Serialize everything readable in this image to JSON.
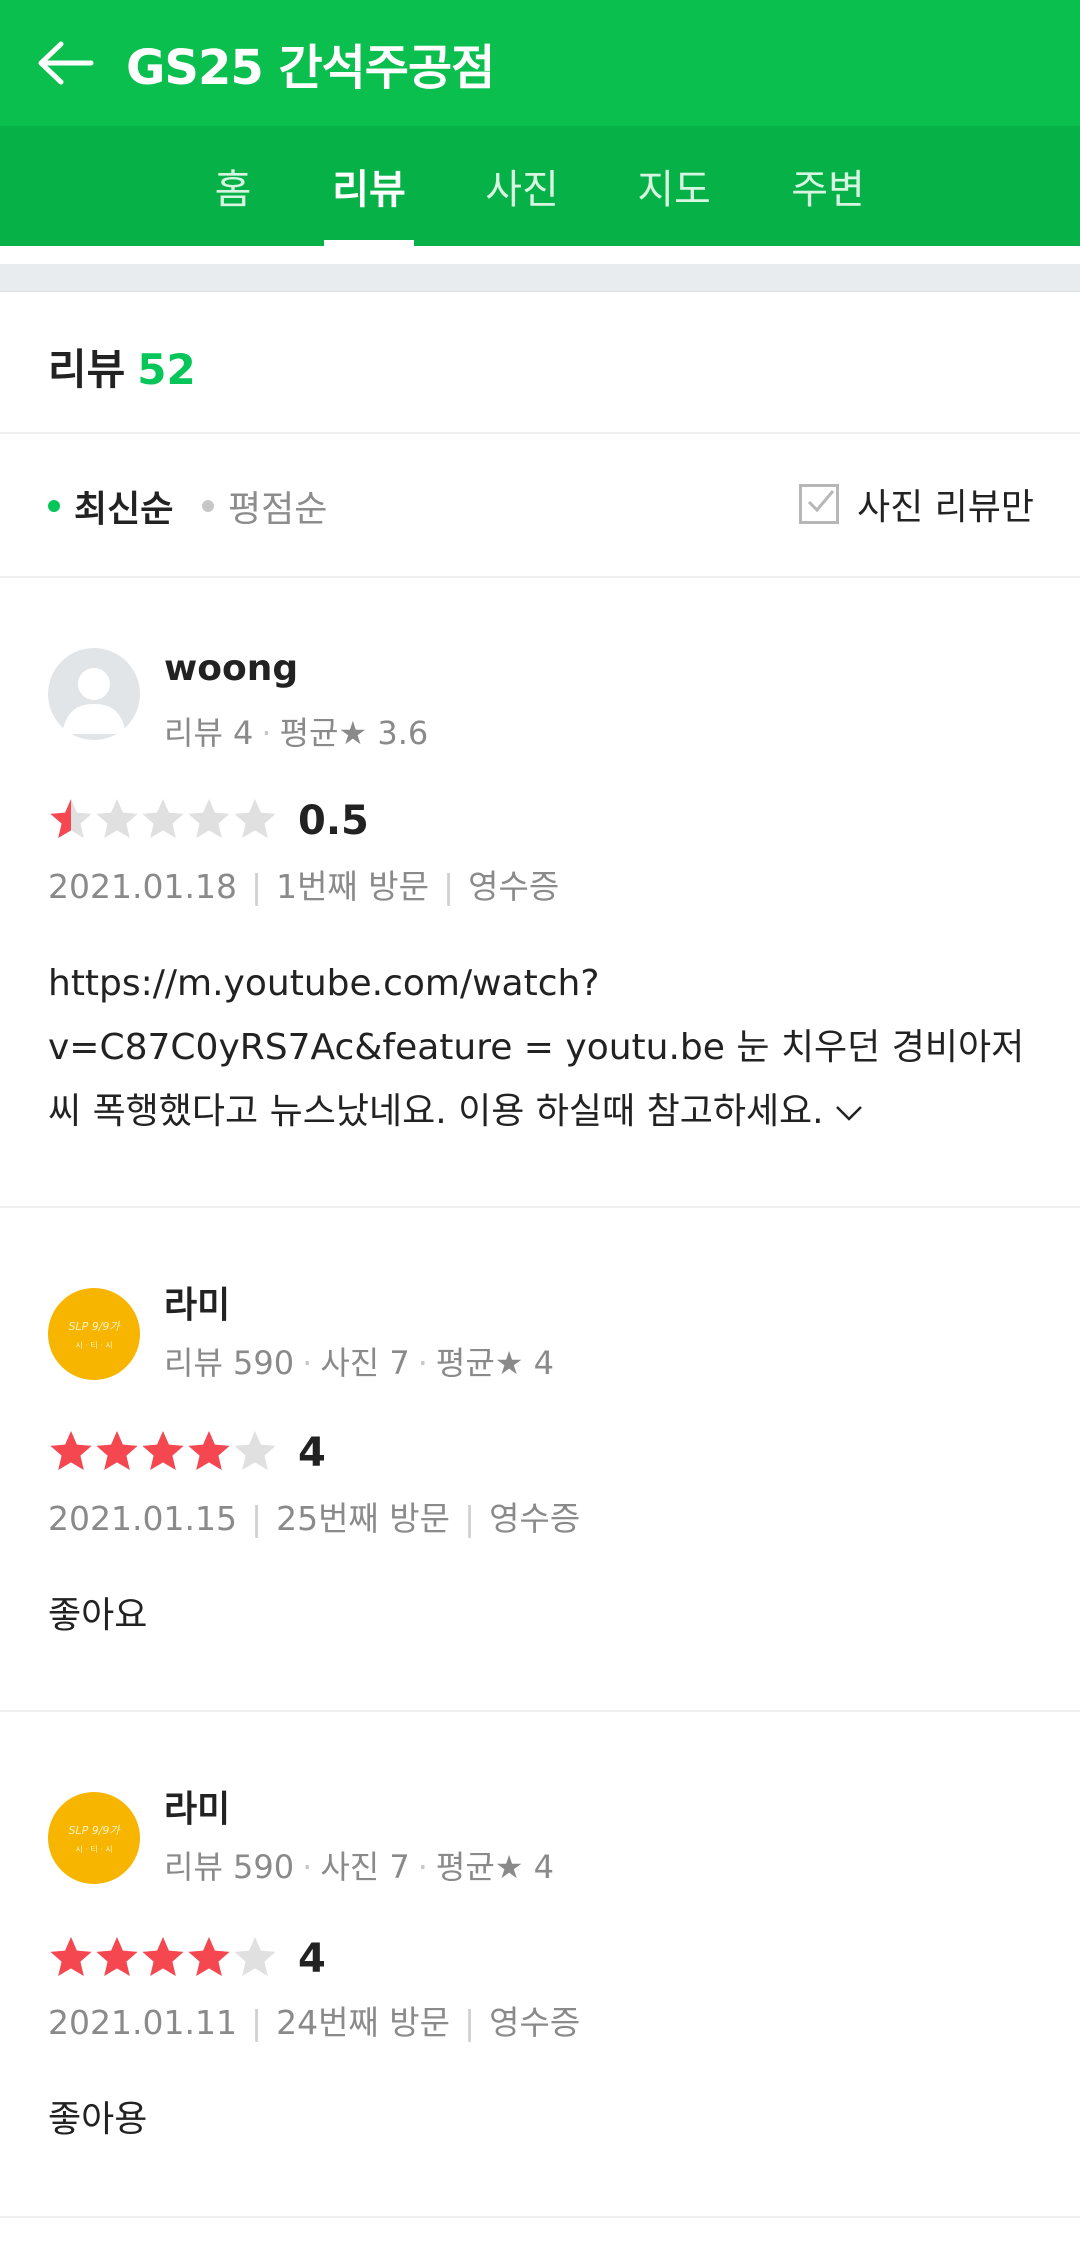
{
  "header": {
    "title": "GS25 간석주공점"
  },
  "tabs": [
    {
      "label": "홈",
      "active": false
    },
    {
      "label": "리뷰",
      "active": true
    },
    {
      "label": "사진",
      "active": false
    },
    {
      "label": "지도",
      "active": false
    },
    {
      "label": "주변",
      "active": false
    }
  ],
  "reviews_section": {
    "label": "리뷰",
    "count": "52"
  },
  "sort": {
    "latest": "최신순",
    "rating": "평점순",
    "photo_only": "사진 리뷰만"
  },
  "colors": {
    "brand_green": "#0abf4e",
    "tab_green": "#06b248",
    "star_red": "#f5474f",
    "star_gray": "#e0e0e0"
  },
  "reviews": [
    {
      "user": "woong",
      "meta": [
        "리뷰 4",
        "평균★ 3.6"
      ],
      "rating": 0.5,
      "rating_text": "0.5",
      "date": "2021.01.18",
      "visit": "1번째 방문",
      "receipt": "영수증",
      "text": "https://m.youtube.com/watch?v=C87C0yRS7Ac&feature = youtu.be 눈 치우던 경비아저씨 폭행했다고 뉴스났네요. 이용 하실때 참고하세요.",
      "avatar": "default"
    },
    {
      "user": "라미",
      "meta": [
        "리뷰 590",
        "사진 7",
        "평균★ 4"
      ],
      "rating": 4,
      "rating_text": "4",
      "date": "2021.01.15",
      "visit": "25번째 방문",
      "receipt": "영수증",
      "text": "좋아요",
      "avatar": "yellow"
    },
    {
      "user": "라미",
      "meta": [
        "리뷰 590",
        "사진 7",
        "평균★ 4"
      ],
      "rating": 4,
      "rating_text": "4",
      "date": "2021.01.11",
      "visit": "24번째 방문",
      "receipt": "영수증",
      "text": "좋아용",
      "avatar": "yellow"
    }
  ],
  "avatar_logo": {
    "line1": "SLP 9/9가",
    "line2": "시 · 티 · 시"
  }
}
